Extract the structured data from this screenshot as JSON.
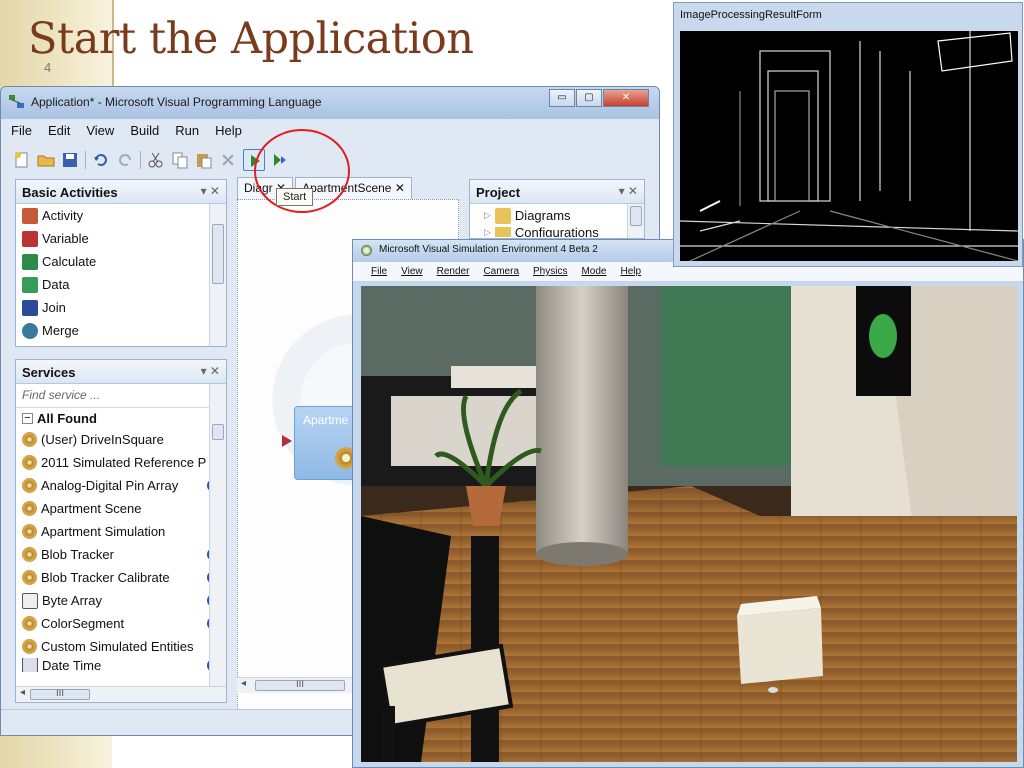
{
  "slide": {
    "title": "Start the Application",
    "number": "4"
  },
  "vpl": {
    "title": "Application* - Microsoft Visual Programming Language",
    "window_buttons": {
      "minimize": "▭",
      "maximize": "▢",
      "close": "✕"
    },
    "menu": [
      "File",
      "Edit",
      "View",
      "Build",
      "Run",
      "Help"
    ],
    "tooltip": "Start",
    "basic_activities": {
      "header": "Basic Activities",
      "items": [
        "Activity",
        "Variable",
        "Calculate",
        "Data",
        "Join",
        "Merge"
      ]
    },
    "services": {
      "header": "Services",
      "search_placeholder": "Find service ...",
      "group": "All Found",
      "items": [
        {
          "label": "(User) DriveInSquare",
          "info": false
        },
        {
          "label": "2011 Simulated Reference P",
          "info": false
        },
        {
          "label": "Analog-Digital Pin Array",
          "info": true
        },
        {
          "label": "Apartment Scene",
          "info": false
        },
        {
          "label": "Apartment Simulation",
          "info": false
        },
        {
          "label": "Blob Tracker",
          "info": true
        },
        {
          "label": "Blob Tracker Calibrate",
          "info": true
        },
        {
          "label": "Byte Array",
          "info": true
        },
        {
          "label": "ColorSegment",
          "info": true
        },
        {
          "label": "Custom Simulated Entities",
          "info": false
        },
        {
          "label": "Date Time",
          "info": true
        }
      ]
    },
    "tabs": [
      "Diagr",
      "ApartmentScene"
    ],
    "node_label": "Apartme",
    "project": {
      "header": "Project",
      "items": [
        "Diagrams",
        "Configurations"
      ]
    },
    "scroll_label": "III"
  },
  "sim": {
    "title": "Microsoft Visual Simulation Environment 4 Beta 2",
    "menu": [
      "File",
      "View",
      "Render",
      "Camera",
      "Physics",
      "Mode",
      "Help"
    ]
  },
  "ipr": {
    "title": "ImageProcessingResultForm"
  },
  "colors": {
    "title": "#7a3a1c",
    "accent_ring": "#e01e1e",
    "window_frame": "#6e8cb0"
  }
}
